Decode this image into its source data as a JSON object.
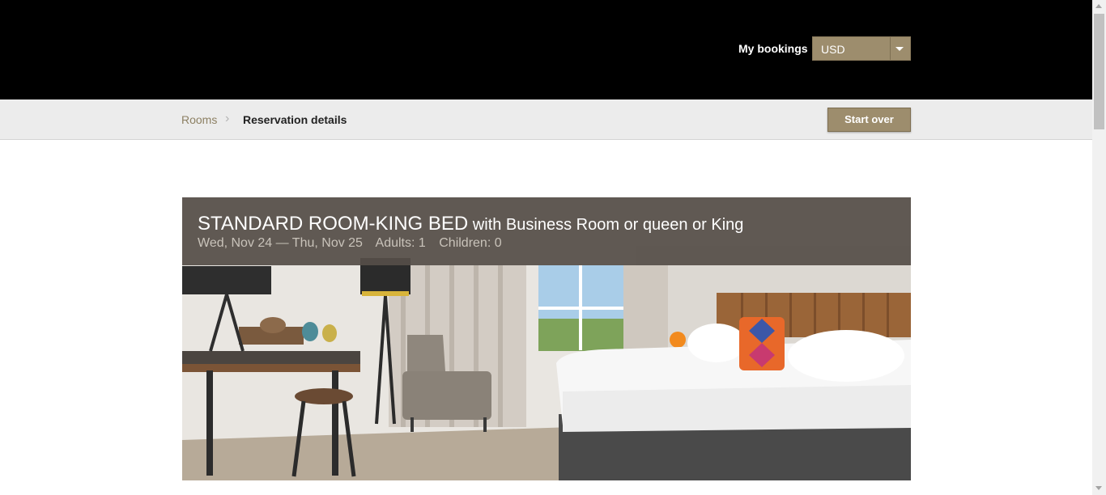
{
  "header": {
    "my_bookings_label": "My bookings",
    "currency": {
      "selected": "USD",
      "icon": "chevron-down-icon"
    }
  },
  "breadcrumb": {
    "rooms_label": "Rooms",
    "separator": "›",
    "current_label": "Reservation details"
  },
  "actions": {
    "start_over_label": "Start over"
  },
  "room": {
    "title": "STANDARD ROOM-KING BED",
    "subtitle": " with Business Room or queen or King",
    "dates": "Wed, Nov 24 — Thu, Nov 25",
    "adults": "Adults: 1",
    "children": "Children: 0",
    "photo": "hotel-room-photo"
  },
  "colors": {
    "topbar": "#000000",
    "accent_gold": "#9d8d6d",
    "subbar": "#ececec",
    "room_header_overlay": "#554e48"
  }
}
